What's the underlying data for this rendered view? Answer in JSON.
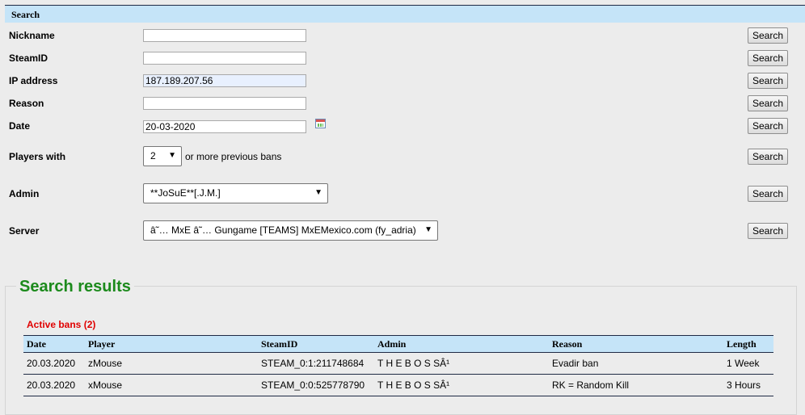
{
  "search": {
    "header": "Search",
    "button_label": "Search",
    "fields": {
      "nickname": {
        "label": "Nickname",
        "value": ""
      },
      "steamid": {
        "label": "SteamID",
        "value": ""
      },
      "ip": {
        "label": "IP address",
        "value": "187.189.207.56"
      },
      "reason": {
        "label": "Reason",
        "value": ""
      },
      "date": {
        "label": "Date",
        "value": "20-03-2020"
      }
    },
    "players_with": {
      "label": "Players with",
      "selected": "2",
      "suffix": "or more previous bans"
    },
    "admin": {
      "label": "Admin",
      "selected": "**JoSuE**[.J.M.]"
    },
    "server": {
      "label": "Server",
      "selected": "â˜… MxE â˜… Gungame [TEAMS] MxEMexico.com (fy_adria)"
    }
  },
  "results": {
    "title": "Search results",
    "active_bans": "Active bans (2)",
    "columns": [
      "Date",
      "Player",
      "SteamID",
      "Admin",
      "Reason",
      "Length"
    ],
    "rows": [
      [
        "20.03.2020",
        "zMouse",
        "STEAM_0:1:211748684",
        "T H E B O S SÂ¹",
        "Evadir ban",
        "1 Week"
      ],
      [
        "20.03.2020",
        "xMouse",
        "STEAM_0:0:525778790",
        "T H E B O S SÂ¹",
        "RK = Random Kill",
        "3 Hours"
      ]
    ]
  }
}
